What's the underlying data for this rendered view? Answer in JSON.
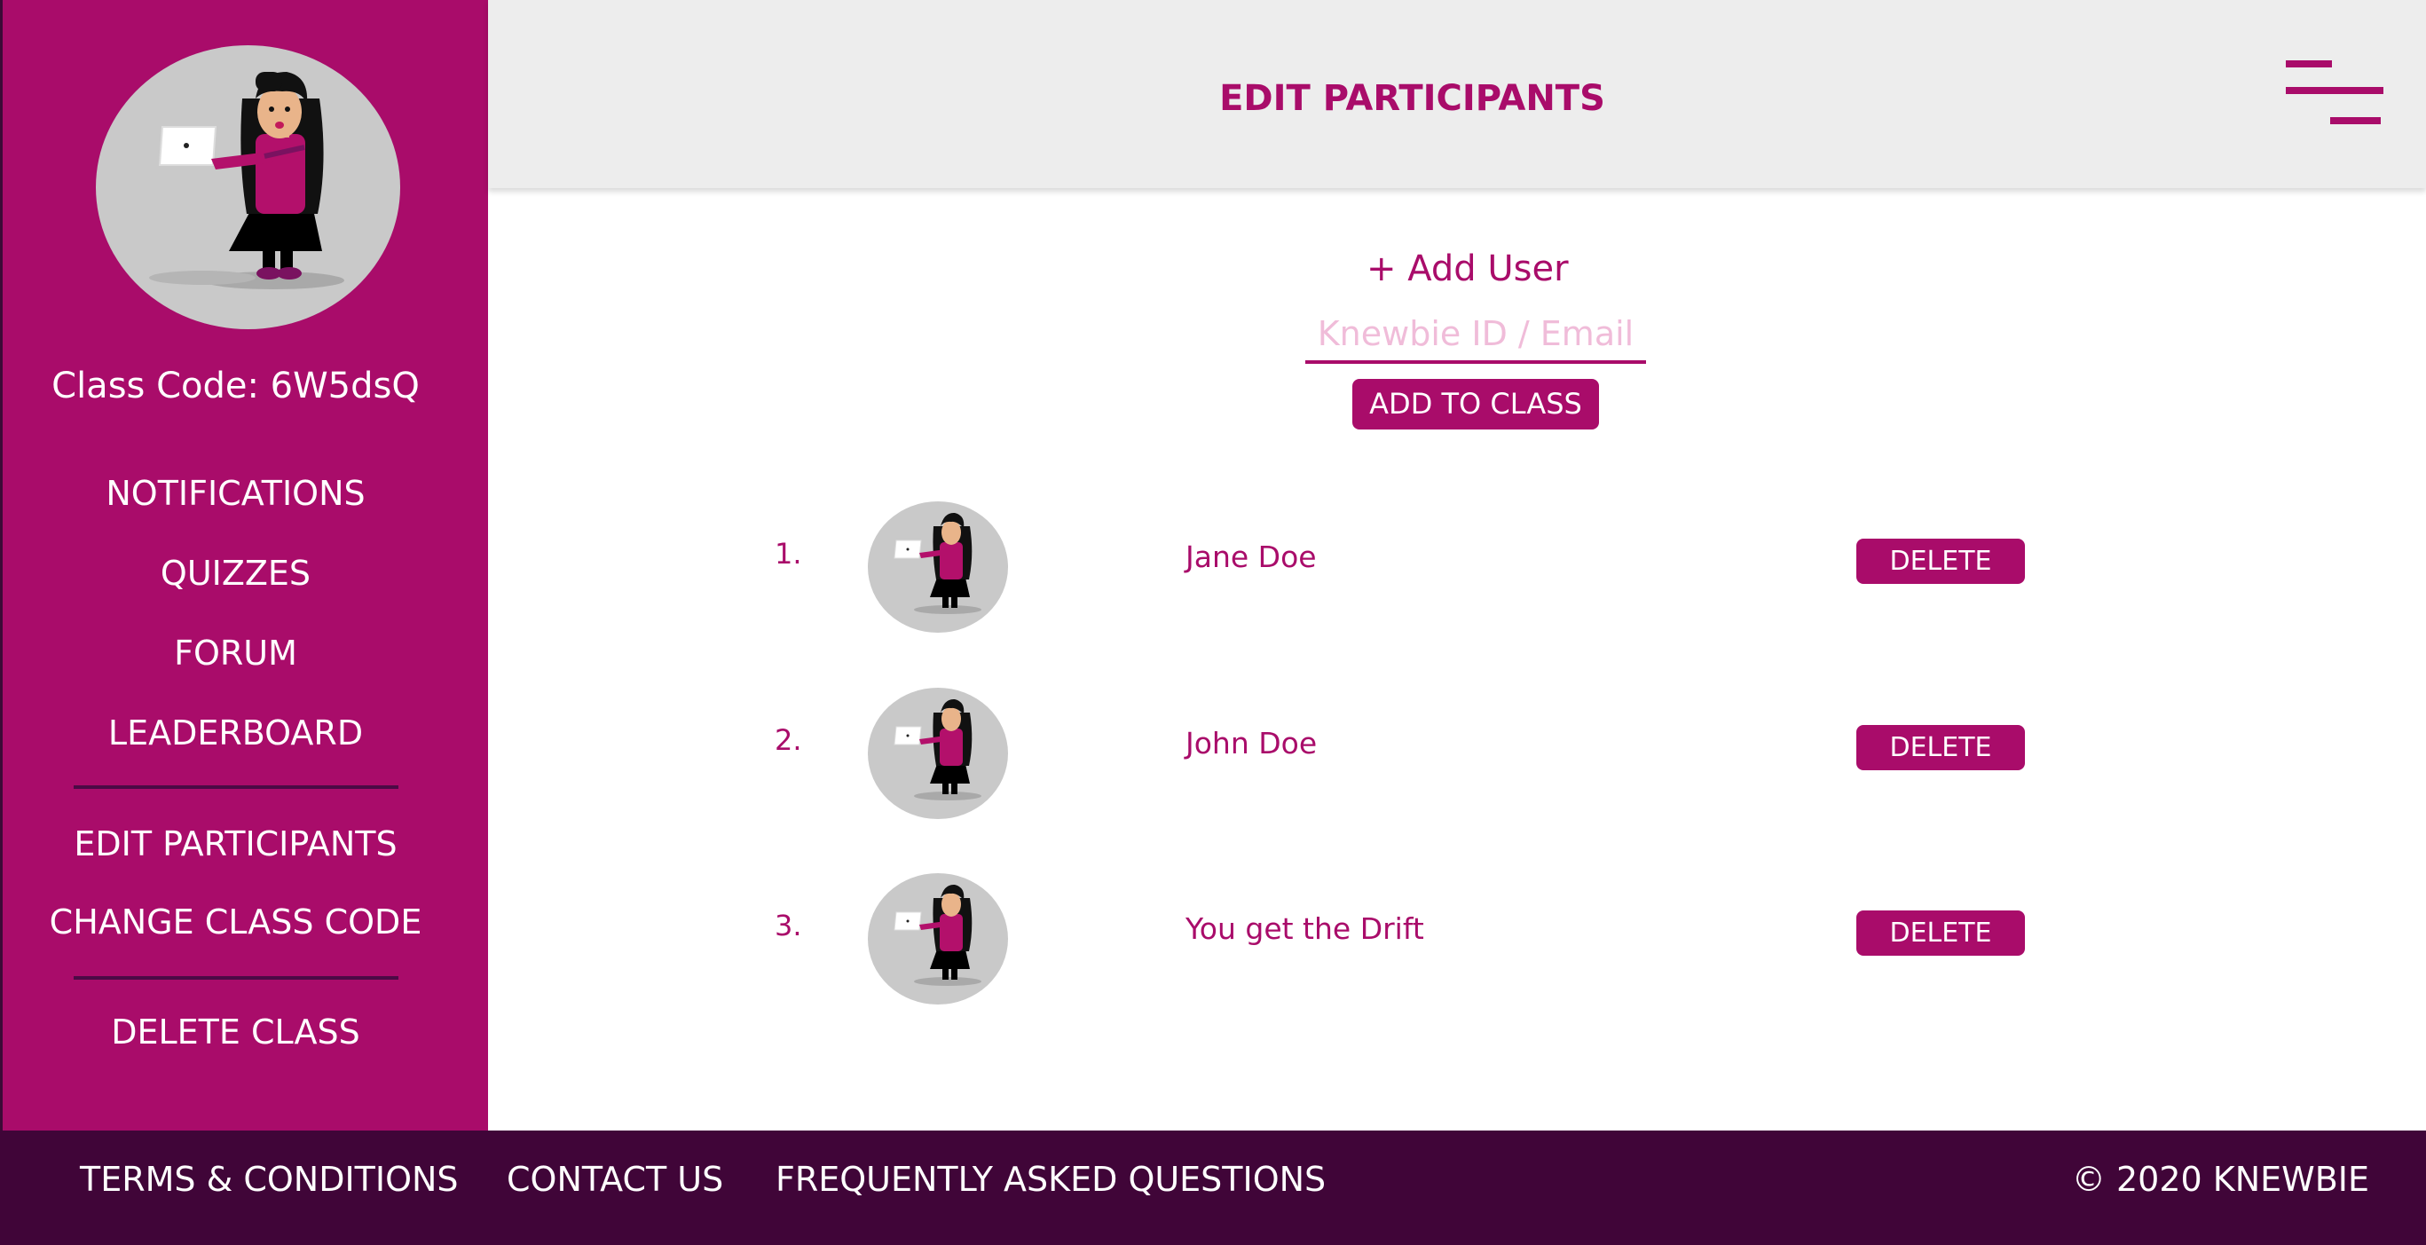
{
  "sidebar": {
    "class_code": "Class Code: 6W5dsQ",
    "nav_primary": [
      "NOTIFICATIONS",
      "QUIZZES",
      "FORUM",
      "LEADERBOARD"
    ],
    "nav_admin": [
      "EDIT PARTICIPANTS",
      "CHANGE CLASS CODE"
    ],
    "nav_danger": [
      "DELETE CLASS"
    ]
  },
  "header": {
    "title": "EDIT PARTICIPANTS",
    "menu_icon": "hamburger-menu-icon"
  },
  "add_user": {
    "label": "+ Add User",
    "placeholder": "Knewbie ID / Email",
    "value": "",
    "button": "ADD TO CLASS"
  },
  "participants": [
    {
      "number": "1.",
      "name": "Jane Doe",
      "action": "DELETE"
    },
    {
      "number": "2.",
      "name": "John Doe",
      "action": "DELETE"
    },
    {
      "number": "3.",
      "name": "You get the Drift",
      "action": "DELETE"
    }
  ],
  "footer": {
    "links": [
      "TERMS & CONDITIONS",
      "CONTACT US",
      "FREQUENTLY ASKED QUESTIONS"
    ],
    "copyright": "© 2020 KNEWBIE"
  },
  "colors": {
    "brand": "#a90c6a",
    "footer": "#400538",
    "header": "#ededed",
    "avatar_bg": "#c9c9c9"
  }
}
